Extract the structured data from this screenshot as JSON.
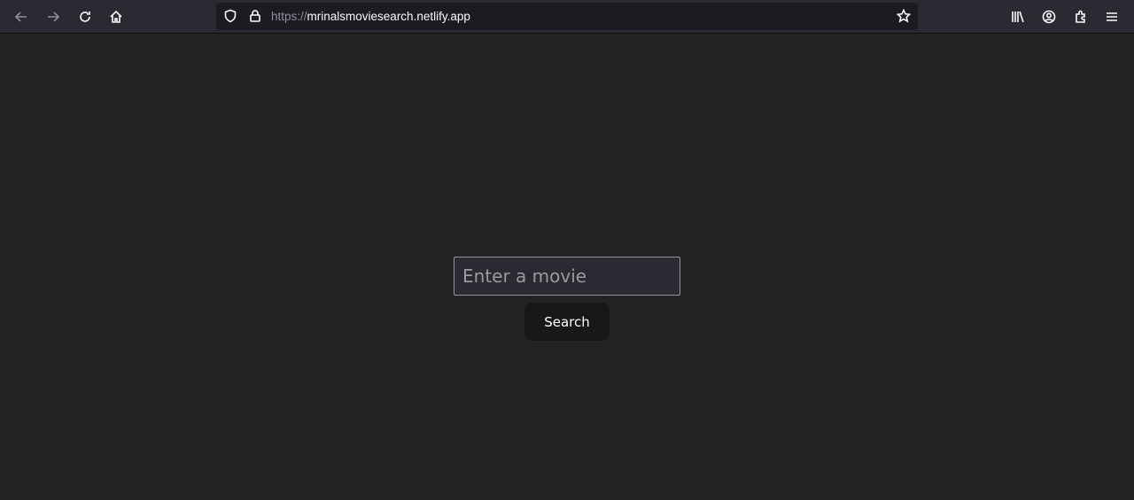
{
  "browser": {
    "url_scheme": "https://",
    "url_host": "mrinalsmoviesearch.netlify.app",
    "icons": [
      "back-icon",
      "forward-icon",
      "reload-icon",
      "home-icon",
      "shield-icon",
      "lock-icon",
      "star-icon",
      "library-icon",
      "account-icon",
      "extensions-icon",
      "menu-icon"
    ]
  },
  "search": {
    "placeholder": "Enter a movie",
    "value": "",
    "button_label": "Search"
  }
}
